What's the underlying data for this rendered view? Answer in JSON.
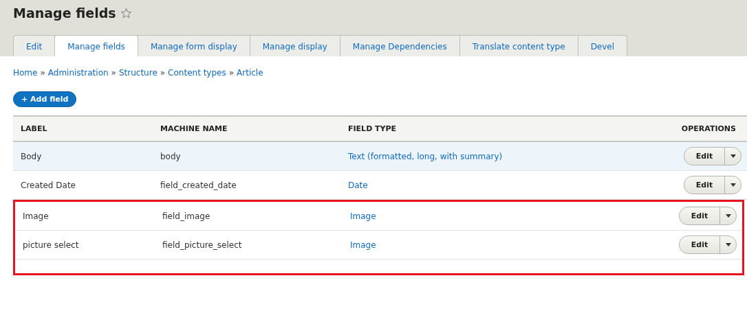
{
  "page": {
    "title": "Manage fields"
  },
  "tabs": [
    {
      "label": "Edit",
      "selected": false
    },
    {
      "label": "Manage fields",
      "selected": true
    },
    {
      "label": "Manage form display",
      "selected": false
    },
    {
      "label": "Manage display",
      "selected": false
    },
    {
      "label": "Manage Dependencies",
      "selected": false
    },
    {
      "label": "Translate content type",
      "selected": false
    },
    {
      "label": "Devel",
      "selected": false
    }
  ],
  "breadcrumb": [
    "Home",
    "Administration",
    "Structure",
    "Content types",
    "Article"
  ],
  "breadcrumb_separator": "»",
  "add_button": "+ Add field",
  "table": {
    "columns": [
      "LABEL",
      "MACHINE NAME",
      "FIELD TYPE",
      "OPERATIONS"
    ],
    "rows": [
      {
        "label": "Body",
        "machine_name": "body",
        "field_type": "Text (formatted, long, with summary)",
        "operation": "Edit",
        "hovered": true,
        "highlighted": false
      },
      {
        "label": "Created Date",
        "machine_name": "field_created_date",
        "field_type": "Date",
        "operation": "Edit",
        "hovered": false,
        "highlighted": false
      },
      {
        "label": "Image",
        "machine_name": "field_image",
        "field_type": "Image",
        "operation": "Edit",
        "hovered": false,
        "highlighted": true
      },
      {
        "label": "picture select",
        "machine_name": "field_picture_select",
        "field_type": "Image",
        "operation": "Edit",
        "hovered": false,
        "highlighted": true
      }
    ]
  }
}
